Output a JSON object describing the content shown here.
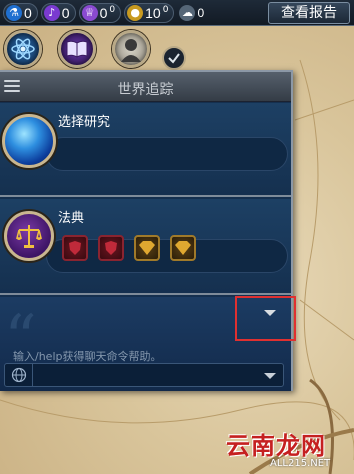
{
  "topbar": {
    "resources": [
      {
        "icon": "science-icon",
        "value": "0",
        "color": "#3aa0ff"
      },
      {
        "icon": "faith-icon",
        "value": "0",
        "color": "#b070ff"
      },
      {
        "icon": "culture-icon",
        "value": "0",
        "sup": "0",
        "color": "#c070ff"
      },
      {
        "icon": "gold-icon",
        "value": "10",
        "sup": "0",
        "color": "#e8c040"
      },
      {
        "icon": "tourism-icon",
        "value": "0",
        "color": "#ffffff"
      }
    ],
    "report_button": "查看报告"
  },
  "panel": {
    "title": "世界追踪",
    "research_label": "选择研究",
    "policy_label": "法典",
    "policy_slots": [
      "military",
      "military",
      "economic",
      "economic"
    ]
  },
  "chat": {
    "help_text": "输入/help获得聊天命令帮助。"
  },
  "watermark": {
    "text": "云南龙网",
    "sub": "ALL215.NET"
  }
}
